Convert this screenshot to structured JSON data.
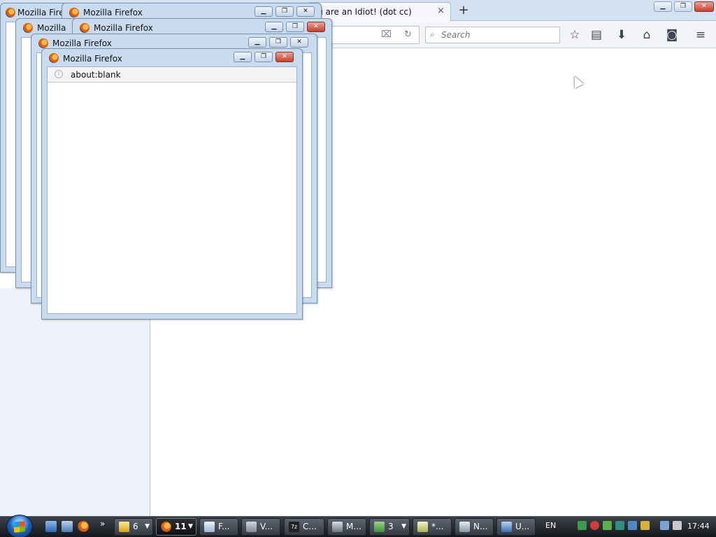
{
  "main_window": {
    "tab_title": "You are an Idiot! (dot cc)",
    "tab_close": "×",
    "new_tab": "+",
    "window_buttons": {
      "minimize": "▁",
      "restore": "❐",
      "close": "✕"
    },
    "search_placeholder": "Search",
    "toolbar_icons": [
      "bookmark-star-icon",
      "reading-list-icon",
      "download-icon",
      "home-icon",
      "pocket-icon",
      "menu-icon"
    ]
  },
  "popups": [
    {
      "title": "Mozilla Fire"
    },
    {
      "title": "Mozilla Firefox"
    },
    {
      "title": "Mozilla"
    },
    {
      "title": "Mozilla Firefox"
    },
    {
      "title": "Mozilla Firefox"
    },
    {
      "title": "Mozilla Firefox",
      "address": "about:blank"
    }
  ],
  "taskbar": {
    "items": [
      {
        "label": "6",
        "icon": "folder-icon"
      },
      {
        "label": "11",
        "icon": "firefox-icon"
      },
      {
        "label": "F...",
        "icon": "notepad-icon"
      },
      {
        "label": "V...",
        "icon": "speaker-icon"
      },
      {
        "label": "C...",
        "icon": "7zip-icon"
      },
      {
        "label": "M...",
        "icon": "machine-icon"
      },
      {
        "label": "3",
        "icon": "users-icon"
      },
      {
        "label": "*...",
        "icon": "editor-icon"
      },
      {
        "label": "N...",
        "icon": "network-icon"
      },
      {
        "label": "U...",
        "icon": "utility-icon"
      }
    ],
    "language": "EN",
    "clock": "17:44",
    "overflow": "»"
  },
  "colors": {
    "titlebar": "#c9dcef",
    "taskbar": "#1f2328",
    "close": "#c5402e"
  }
}
